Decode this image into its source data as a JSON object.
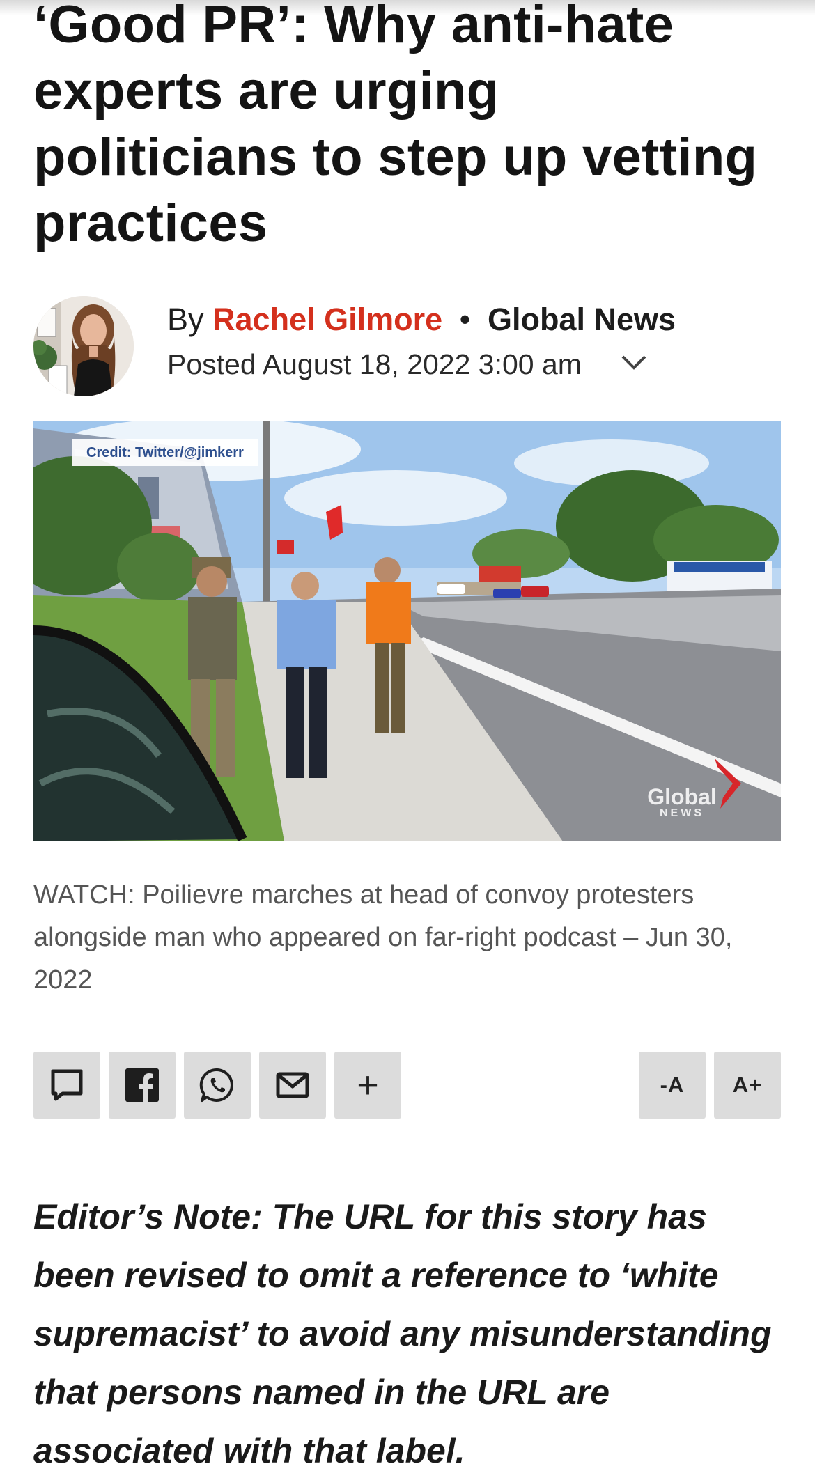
{
  "article": {
    "headline": "‘Good PR’: Why anti-hate experts are urging politicians to step up vetting practices",
    "by_label": "By",
    "author": "Rachel Gilmore",
    "separator": "•",
    "source": "Global News",
    "posted": "Posted August 18, 2022 3:00 am"
  },
  "media": {
    "credit": "Credit: Twitter/@jimkerr",
    "watermark_top": "Global",
    "watermark_bottom": "NEWS",
    "caption": "WATCH: Poilievre marches at head of convoy protesters alongside man who appeared on far-right podcast – Jun 30, 2022"
  },
  "share": {
    "icons": [
      "comment-icon",
      "facebook-icon",
      "whatsapp-icon",
      "email-icon"
    ],
    "more_label": "+",
    "decrease_font_label": "-A",
    "increase_font_label": "A+"
  },
  "editors_note": "Editor’s Note: The URL for this story has been revised to omit a reference to ‘white supremacist’ to avoid any misunderstanding that persons named in the URL are associated with that label.",
  "colors": {
    "author_red": "#d4301d",
    "button_gray": "#dcdcdc",
    "caption_gray": "#555555"
  }
}
